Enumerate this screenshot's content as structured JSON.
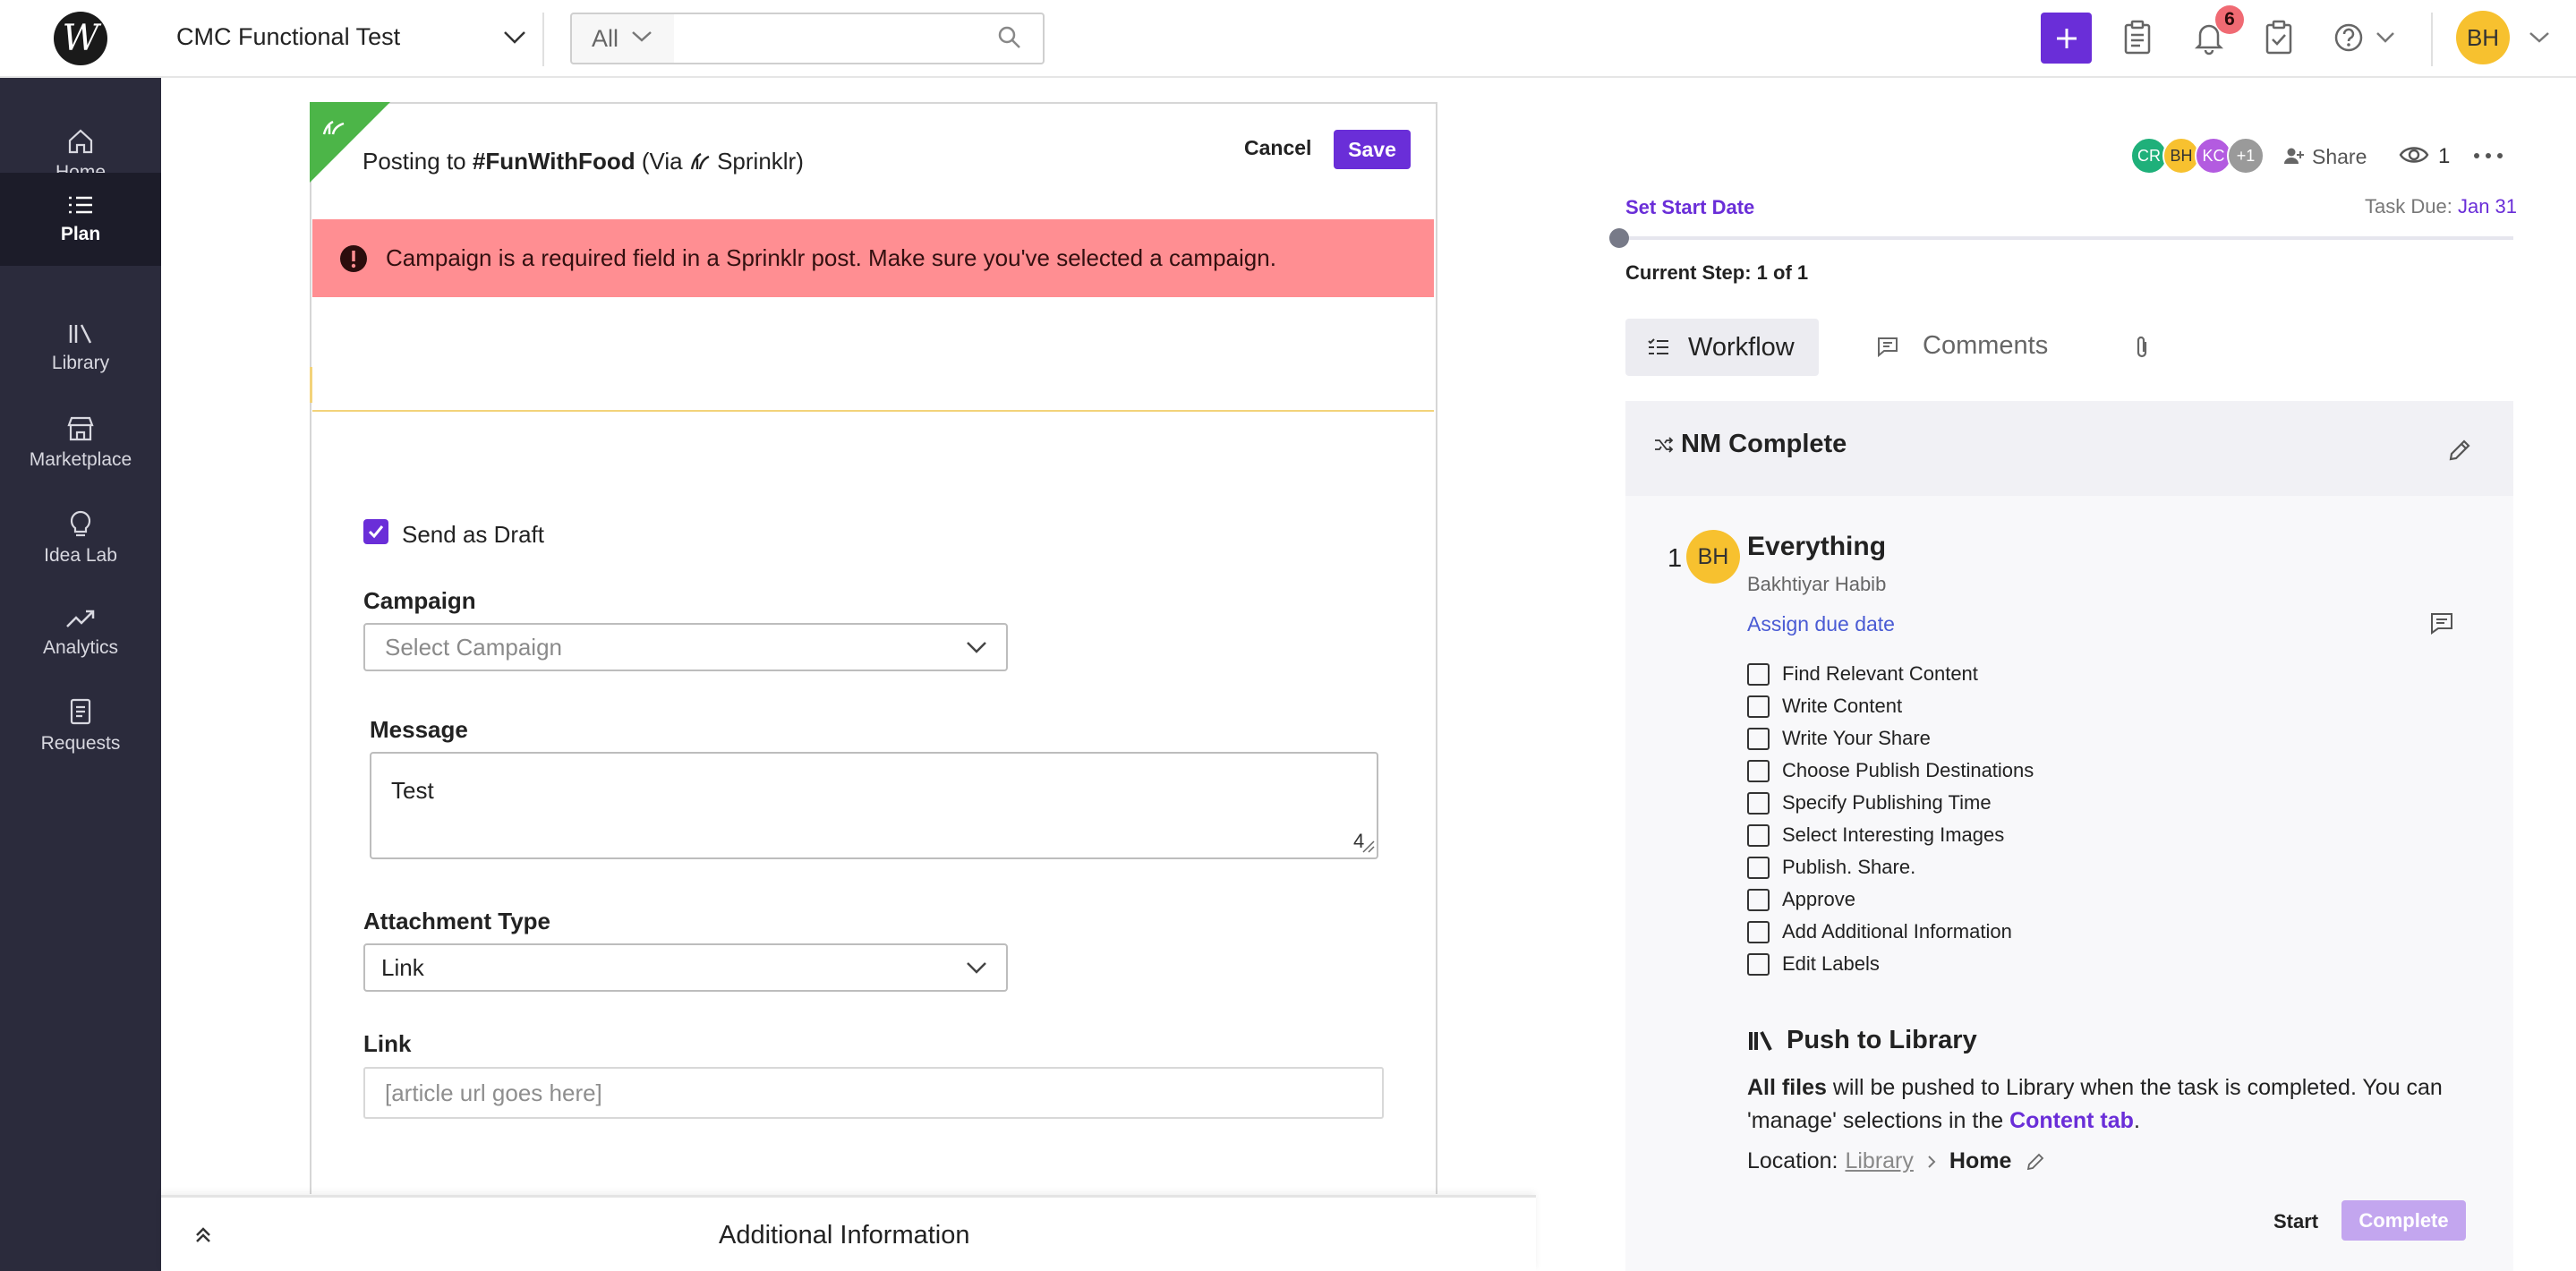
{
  "topbar": {
    "logo_letter": "W",
    "workspace": "CMC Functional Test",
    "filter_value": "All",
    "search_placeholder": "",
    "notification_count": "6",
    "user_initials": "BH",
    "accent": "#6a2ed8"
  },
  "sidebar": {
    "items": [
      {
        "label": "Home",
        "icon": "home-icon"
      },
      {
        "label": "Plan",
        "icon": "list-icon"
      },
      {
        "label": "Library",
        "icon": "library-icon"
      },
      {
        "label": "Marketplace",
        "icon": "store-icon"
      },
      {
        "label": "Idea Lab",
        "icon": "bulb-icon"
      },
      {
        "label": "Analytics",
        "icon": "trend-icon"
      },
      {
        "label": "Requests",
        "icon": "document-icon"
      }
    ],
    "active": "Plan"
  },
  "post": {
    "posting_to_prefix": "Posting to",
    "channel": "#FunWithFood",
    "via_prefix": "(Via",
    "via_name": "Sprinklr)",
    "cancel_label": "Cancel",
    "save_label": "Save",
    "alert": "Campaign is a required field in a Sprinklr post. Make sure you've selected a campaign.",
    "send_as_draft_label": "Send as Draft",
    "send_as_draft_checked": true,
    "campaign_label": "Campaign",
    "campaign_placeholder": "Select Campaign",
    "message_label": "Message",
    "message_value": "Test",
    "message_count": "4",
    "attachment_type_label": "Attachment Type",
    "attachment_type_value": "Link",
    "link_label": "Link",
    "link_placeholder": "[article url goes here]"
  },
  "additional_info": {
    "label": "Additional Information"
  },
  "panel": {
    "collaborators": [
      {
        "initials": "CR",
        "color": "#1fb07a"
      },
      {
        "initials": "BH",
        "color": "#f7c12f"
      },
      {
        "initials": "KC",
        "color": "#b35be0"
      },
      {
        "initials": "+1",
        "color": "#9a9a9a"
      }
    ],
    "share_label": "Share",
    "view_count": "1",
    "set_start_date": "Set Start Date",
    "task_due_label": "Task Due:",
    "task_due_date": "Jan 31",
    "current_step": "Current Step: 1 of 1",
    "tabs": {
      "workflow": "Workflow",
      "comments": "Comments"
    },
    "workflow_name": "NM Complete",
    "step": {
      "number": "1",
      "avatar": "BH",
      "title": "Everything",
      "assignee": "Bakhtiyar Habib",
      "assign_due": "Assign due date",
      "checklist": [
        "Find Relevant Content",
        "Write Content",
        "Write Your Share",
        "Choose Publish Destinations",
        "Specify Publishing Time",
        "Select Interesting Images",
        "Publish. Share.",
        "Approve",
        "Add Additional Information",
        "Edit Labels"
      ]
    },
    "push": {
      "title": "Push to Library",
      "desc_bold": "All files",
      "desc_1": " will be pushed to Library when the task is completed. You can 'manage' selections in the ",
      "desc_link": "Content tab",
      "desc_end": ".",
      "location_label": "Location:",
      "location_library": "Library",
      "location_home": "Home"
    },
    "start_label": "Start",
    "complete_label": "Complete"
  }
}
